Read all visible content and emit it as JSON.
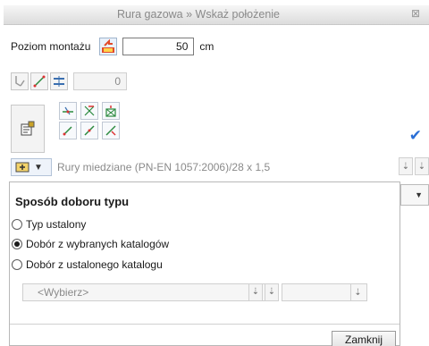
{
  "window": {
    "title": "Rura gazowa » Wskaż położenie",
    "close_glyph": "⊠"
  },
  "mounting": {
    "label": "Poziom montażu",
    "value": "50",
    "unit": "cm"
  },
  "tools1": {
    "count_value": "0"
  },
  "pipe": {
    "selected_text": "Rury miedziane (PN-EN 1057:2006)/28 x 1,5",
    "dropdown_arrow": "▼"
  },
  "popup": {
    "title": "Sposób doboru typu",
    "options": [
      {
        "label": "Typ ustalony",
        "selected": false
      },
      {
        "label": "Dobór z wybranych katalogów",
        "selected": true
      },
      {
        "label": "Dobór z ustalonego katalogu",
        "selected": false
      }
    ],
    "catalog_placeholder": "<Wybierz>",
    "close_label": "Zamknij"
  },
  "colors": {
    "accent": "#2a6fd6",
    "disabled_text": "#8a8a8a"
  }
}
